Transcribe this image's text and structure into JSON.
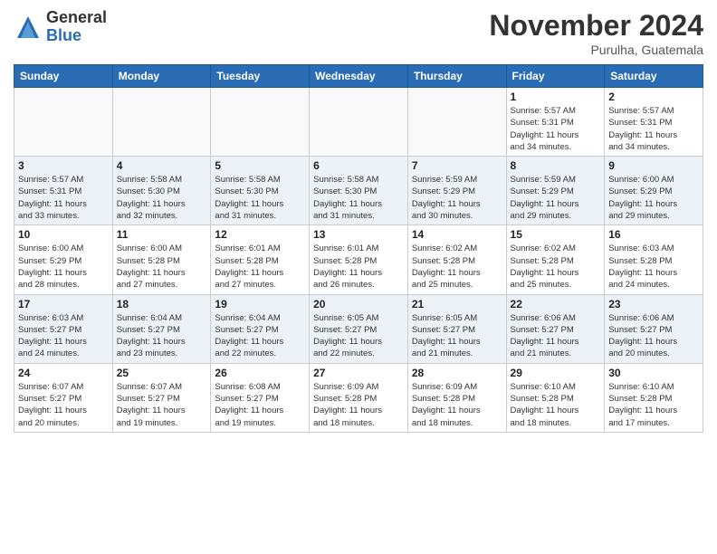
{
  "header": {
    "logo_general": "General",
    "logo_blue": "Blue",
    "month_title": "November 2024",
    "location": "Purulha, Guatemala"
  },
  "weekdays": [
    "Sunday",
    "Monday",
    "Tuesday",
    "Wednesday",
    "Thursday",
    "Friday",
    "Saturday"
  ],
  "weeks": [
    [
      {
        "day": "",
        "info": ""
      },
      {
        "day": "",
        "info": ""
      },
      {
        "day": "",
        "info": ""
      },
      {
        "day": "",
        "info": ""
      },
      {
        "day": "",
        "info": ""
      },
      {
        "day": "1",
        "info": "Sunrise: 5:57 AM\nSunset: 5:31 PM\nDaylight: 11 hours\nand 34 minutes."
      },
      {
        "day": "2",
        "info": "Sunrise: 5:57 AM\nSunset: 5:31 PM\nDaylight: 11 hours\nand 34 minutes."
      }
    ],
    [
      {
        "day": "3",
        "info": "Sunrise: 5:57 AM\nSunset: 5:31 PM\nDaylight: 11 hours\nand 33 minutes."
      },
      {
        "day": "4",
        "info": "Sunrise: 5:58 AM\nSunset: 5:30 PM\nDaylight: 11 hours\nand 32 minutes."
      },
      {
        "day": "5",
        "info": "Sunrise: 5:58 AM\nSunset: 5:30 PM\nDaylight: 11 hours\nand 31 minutes."
      },
      {
        "day": "6",
        "info": "Sunrise: 5:58 AM\nSunset: 5:30 PM\nDaylight: 11 hours\nand 31 minutes."
      },
      {
        "day": "7",
        "info": "Sunrise: 5:59 AM\nSunset: 5:29 PM\nDaylight: 11 hours\nand 30 minutes."
      },
      {
        "day": "8",
        "info": "Sunrise: 5:59 AM\nSunset: 5:29 PM\nDaylight: 11 hours\nand 29 minutes."
      },
      {
        "day": "9",
        "info": "Sunrise: 6:00 AM\nSunset: 5:29 PM\nDaylight: 11 hours\nand 29 minutes."
      }
    ],
    [
      {
        "day": "10",
        "info": "Sunrise: 6:00 AM\nSunset: 5:29 PM\nDaylight: 11 hours\nand 28 minutes."
      },
      {
        "day": "11",
        "info": "Sunrise: 6:00 AM\nSunset: 5:28 PM\nDaylight: 11 hours\nand 27 minutes."
      },
      {
        "day": "12",
        "info": "Sunrise: 6:01 AM\nSunset: 5:28 PM\nDaylight: 11 hours\nand 27 minutes."
      },
      {
        "day": "13",
        "info": "Sunrise: 6:01 AM\nSunset: 5:28 PM\nDaylight: 11 hours\nand 26 minutes."
      },
      {
        "day": "14",
        "info": "Sunrise: 6:02 AM\nSunset: 5:28 PM\nDaylight: 11 hours\nand 25 minutes."
      },
      {
        "day": "15",
        "info": "Sunrise: 6:02 AM\nSunset: 5:28 PM\nDaylight: 11 hours\nand 25 minutes."
      },
      {
        "day": "16",
        "info": "Sunrise: 6:03 AM\nSunset: 5:28 PM\nDaylight: 11 hours\nand 24 minutes."
      }
    ],
    [
      {
        "day": "17",
        "info": "Sunrise: 6:03 AM\nSunset: 5:27 PM\nDaylight: 11 hours\nand 24 minutes."
      },
      {
        "day": "18",
        "info": "Sunrise: 6:04 AM\nSunset: 5:27 PM\nDaylight: 11 hours\nand 23 minutes."
      },
      {
        "day": "19",
        "info": "Sunrise: 6:04 AM\nSunset: 5:27 PM\nDaylight: 11 hours\nand 22 minutes."
      },
      {
        "day": "20",
        "info": "Sunrise: 6:05 AM\nSunset: 5:27 PM\nDaylight: 11 hours\nand 22 minutes."
      },
      {
        "day": "21",
        "info": "Sunrise: 6:05 AM\nSunset: 5:27 PM\nDaylight: 11 hours\nand 21 minutes."
      },
      {
        "day": "22",
        "info": "Sunrise: 6:06 AM\nSunset: 5:27 PM\nDaylight: 11 hours\nand 21 minutes."
      },
      {
        "day": "23",
        "info": "Sunrise: 6:06 AM\nSunset: 5:27 PM\nDaylight: 11 hours\nand 20 minutes."
      }
    ],
    [
      {
        "day": "24",
        "info": "Sunrise: 6:07 AM\nSunset: 5:27 PM\nDaylight: 11 hours\nand 20 minutes."
      },
      {
        "day": "25",
        "info": "Sunrise: 6:07 AM\nSunset: 5:27 PM\nDaylight: 11 hours\nand 19 minutes."
      },
      {
        "day": "26",
        "info": "Sunrise: 6:08 AM\nSunset: 5:27 PM\nDaylight: 11 hours\nand 19 minutes."
      },
      {
        "day": "27",
        "info": "Sunrise: 6:09 AM\nSunset: 5:28 PM\nDaylight: 11 hours\nand 18 minutes."
      },
      {
        "day": "28",
        "info": "Sunrise: 6:09 AM\nSunset: 5:28 PM\nDaylight: 11 hours\nand 18 minutes."
      },
      {
        "day": "29",
        "info": "Sunrise: 6:10 AM\nSunset: 5:28 PM\nDaylight: 11 hours\nand 18 minutes."
      },
      {
        "day": "30",
        "info": "Sunrise: 6:10 AM\nSunset: 5:28 PM\nDaylight: 11 hours\nand 17 minutes."
      }
    ]
  ]
}
